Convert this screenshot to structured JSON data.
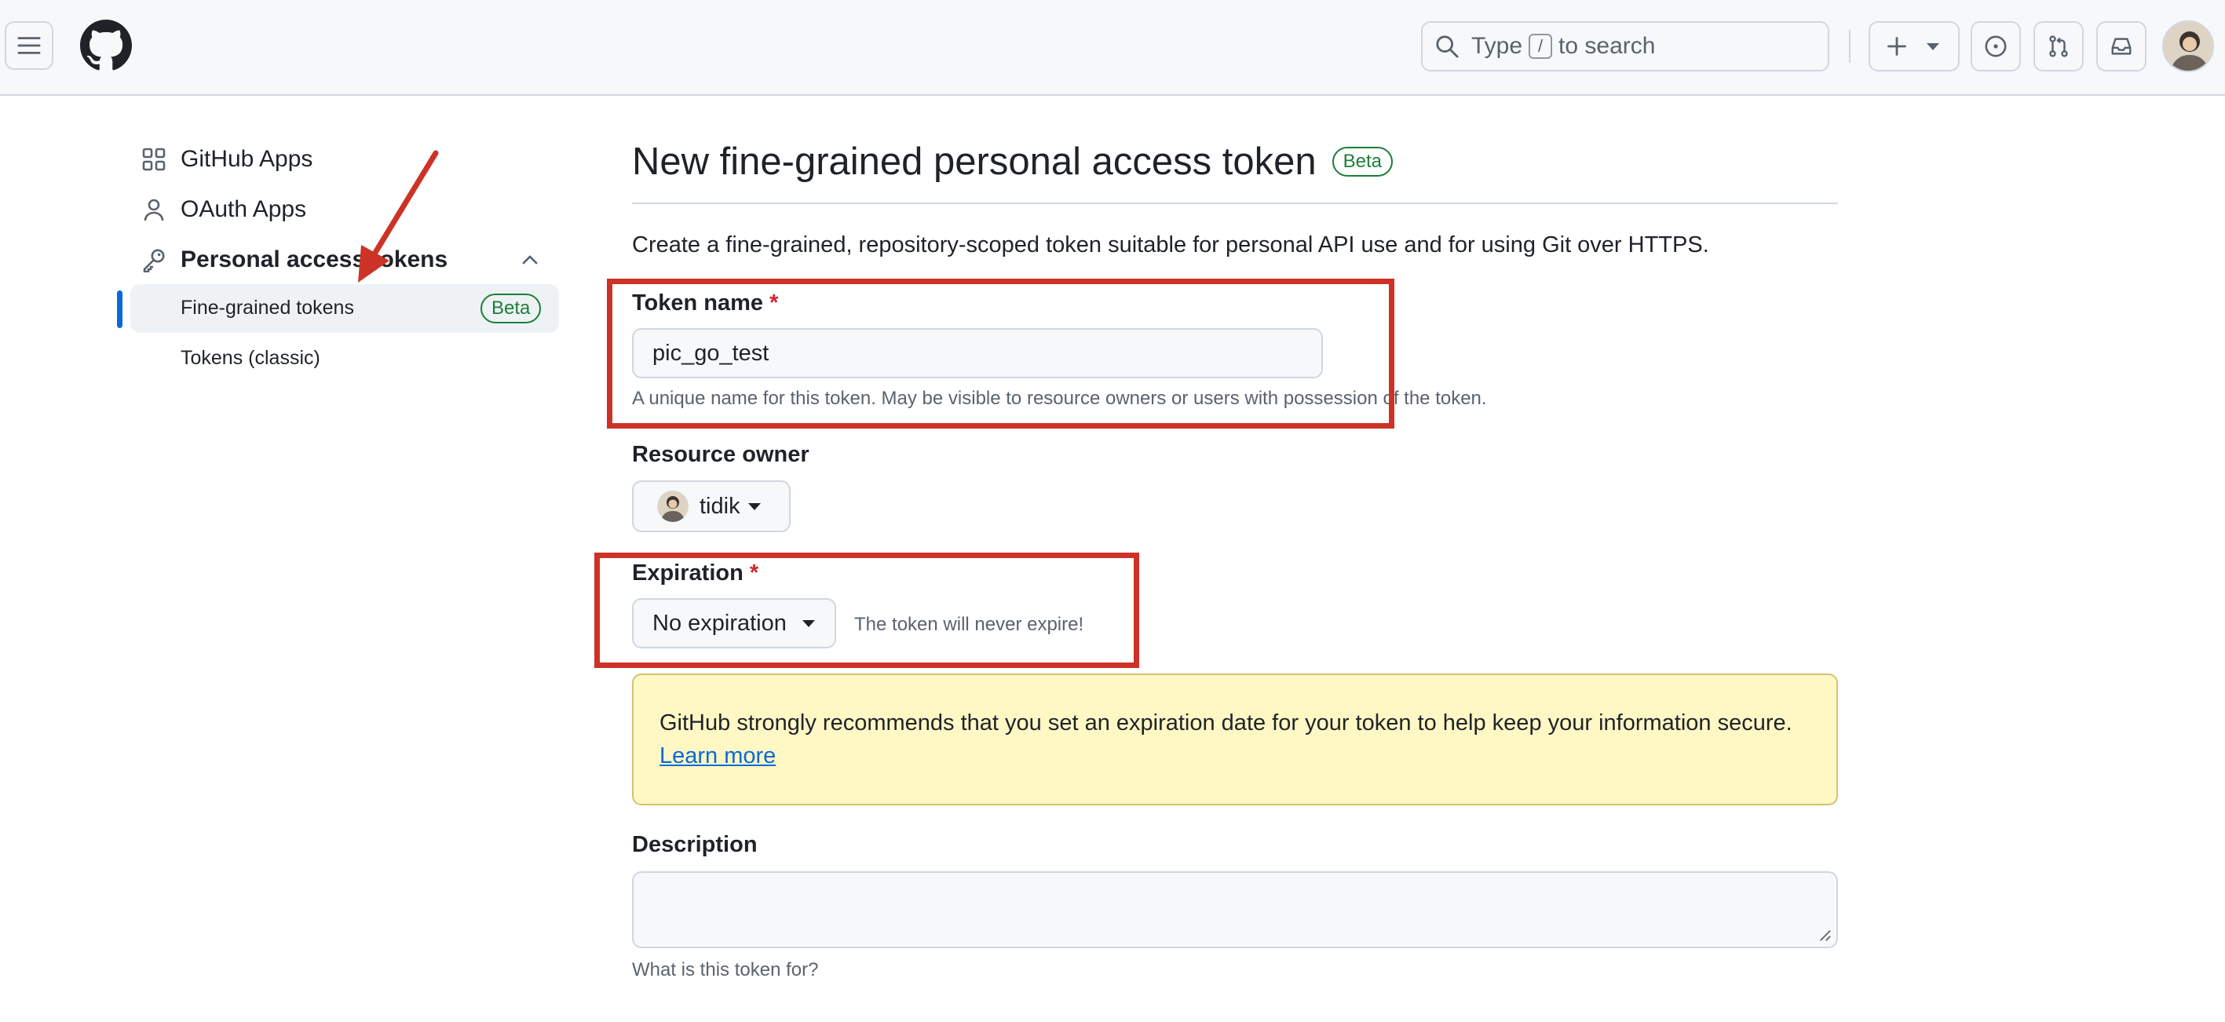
{
  "header": {
    "search": {
      "prefix": "Type",
      "key": "/",
      "suffix": "to search"
    }
  },
  "sidebar": {
    "items": [
      {
        "label": "GitHub Apps",
        "icon": "apps-icon"
      },
      {
        "label": "OAuth Apps",
        "icon": "person-icon"
      },
      {
        "label": "Personal access tokens",
        "icon": "key-icon"
      }
    ],
    "subitems": [
      {
        "label": "Fine-grained tokens",
        "badge": "Beta",
        "selected": true
      },
      {
        "label": "Tokens (classic)"
      }
    ]
  },
  "main": {
    "title": "New fine-grained personal access token",
    "title_badge": "Beta",
    "intro": "Create a fine-grained, repository-scoped token suitable for personal API use and for using Git over HTTPS.",
    "token_name": {
      "label": "Token name",
      "required_mark": "*",
      "value": "pic_go_test",
      "hint": "A unique name for this token. May be visible to resource owners or users with possession of the token."
    },
    "resource_owner": {
      "label": "Resource owner",
      "value": "tidik"
    },
    "expiration": {
      "label": "Expiration",
      "required_mark": "*",
      "value": "No expiration",
      "note": "The token will never expire!"
    },
    "warning": {
      "text": "GitHub strongly recommends that you set an expiration date for your token to help keep your information secure.",
      "link": "Learn more"
    },
    "description": {
      "label": "Description",
      "value": "",
      "hint": "What is this token for?"
    }
  },
  "colors": {
    "annotation": "#cc3326",
    "accent": "#0969da",
    "success": "#1a7f37",
    "danger": "#d1242f",
    "warning_bg": "#fff8c5"
  }
}
